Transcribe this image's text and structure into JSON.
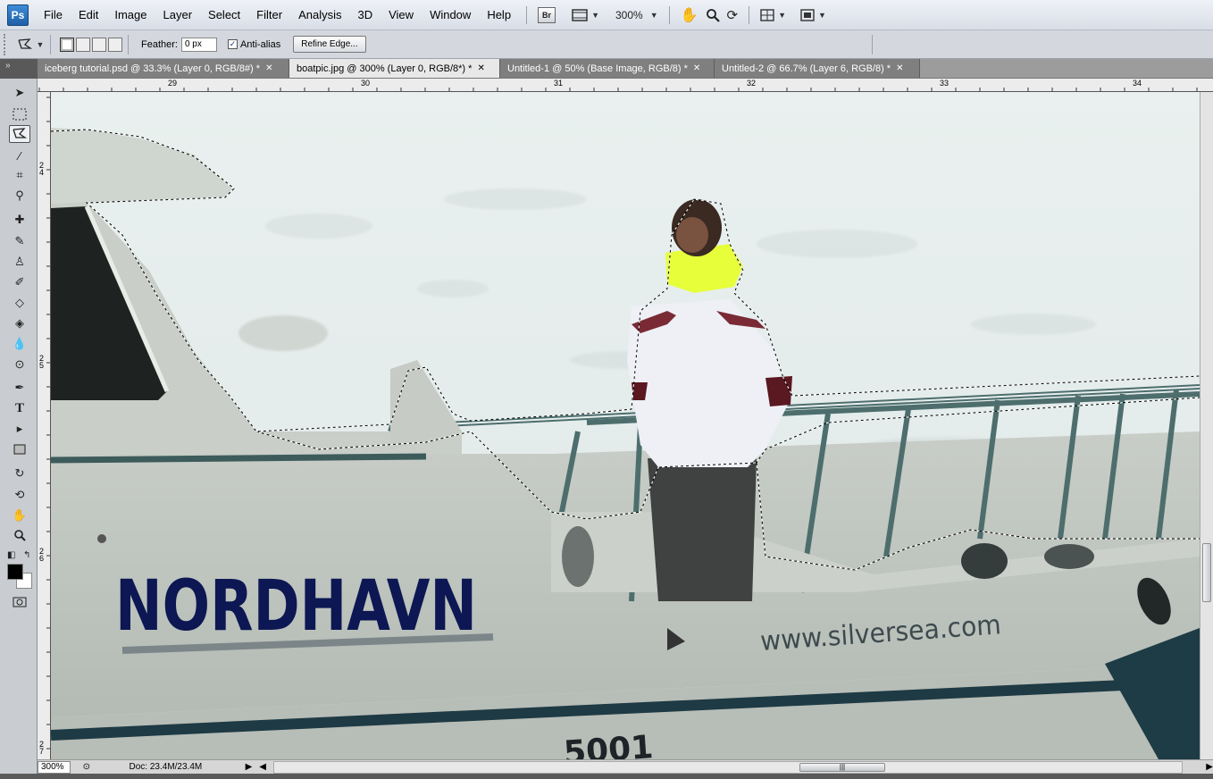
{
  "app": {
    "logo": "Ps",
    "menus": [
      "File",
      "Edit",
      "Image",
      "Layer",
      "Select",
      "Filter",
      "Analysis",
      "3D",
      "View",
      "Window",
      "Help"
    ],
    "bridge_label": "Br",
    "zoom_level": "300%"
  },
  "options": {
    "feather_label": "Feather:",
    "feather_value": "0 px",
    "antialias_label": "Anti-alias",
    "antialias_checked": true,
    "refine_edge_label": "Refine Edge..."
  },
  "tabs": [
    {
      "label": "iceberg tutorial.psd @ 33.3% (Layer 0, RGB/8#) *",
      "active": false
    },
    {
      "label": "boatpic.jpg @ 300% (Layer 0, RGB/8*) *",
      "active": true
    },
    {
      "label": "Untitled-1 @ 50% (Base Image, RGB/8) *",
      "active": false
    },
    {
      "label": "Untitled-2 @ 66.7% (Layer 6, RGB/8) *",
      "active": false
    }
  ],
  "ruler": {
    "top_labels": [
      "29",
      "30",
      "31",
      "32",
      "33",
      "34"
    ],
    "left_labels": [
      "2\n4",
      "2\n5",
      "2\n6",
      "2\n7"
    ]
  },
  "canvas": {
    "boat_brand": "NORDHAVN",
    "boat_website": "www.silversea.com",
    "hull_number": "5001"
  },
  "status": {
    "zoom": "300%",
    "doc_info": "Doc: 23.4M/23.4M"
  },
  "colors": {
    "foreground": "#000000",
    "background": "#ffffff",
    "tab_active": "#e8e8e8",
    "jacket_collar": "#e5ff3a",
    "boat_text": "#0c1753"
  },
  "tools": [
    "move-icon",
    "marquee-icon",
    "polygonal-lasso-icon",
    "magic-wand-icon",
    "crop-icon",
    "eyedropper-icon",
    "healing-brush-icon",
    "brush-icon",
    "clone-stamp-icon",
    "history-brush-icon",
    "eraser-icon",
    "paint-bucket-icon",
    "blur-icon",
    "dodge-icon",
    "pen-icon",
    "type-icon",
    "path-selection-icon",
    "rectangle-icon",
    "3d-rotate-icon",
    "3d-orbit-icon",
    "hand-icon",
    "zoom-icon"
  ]
}
